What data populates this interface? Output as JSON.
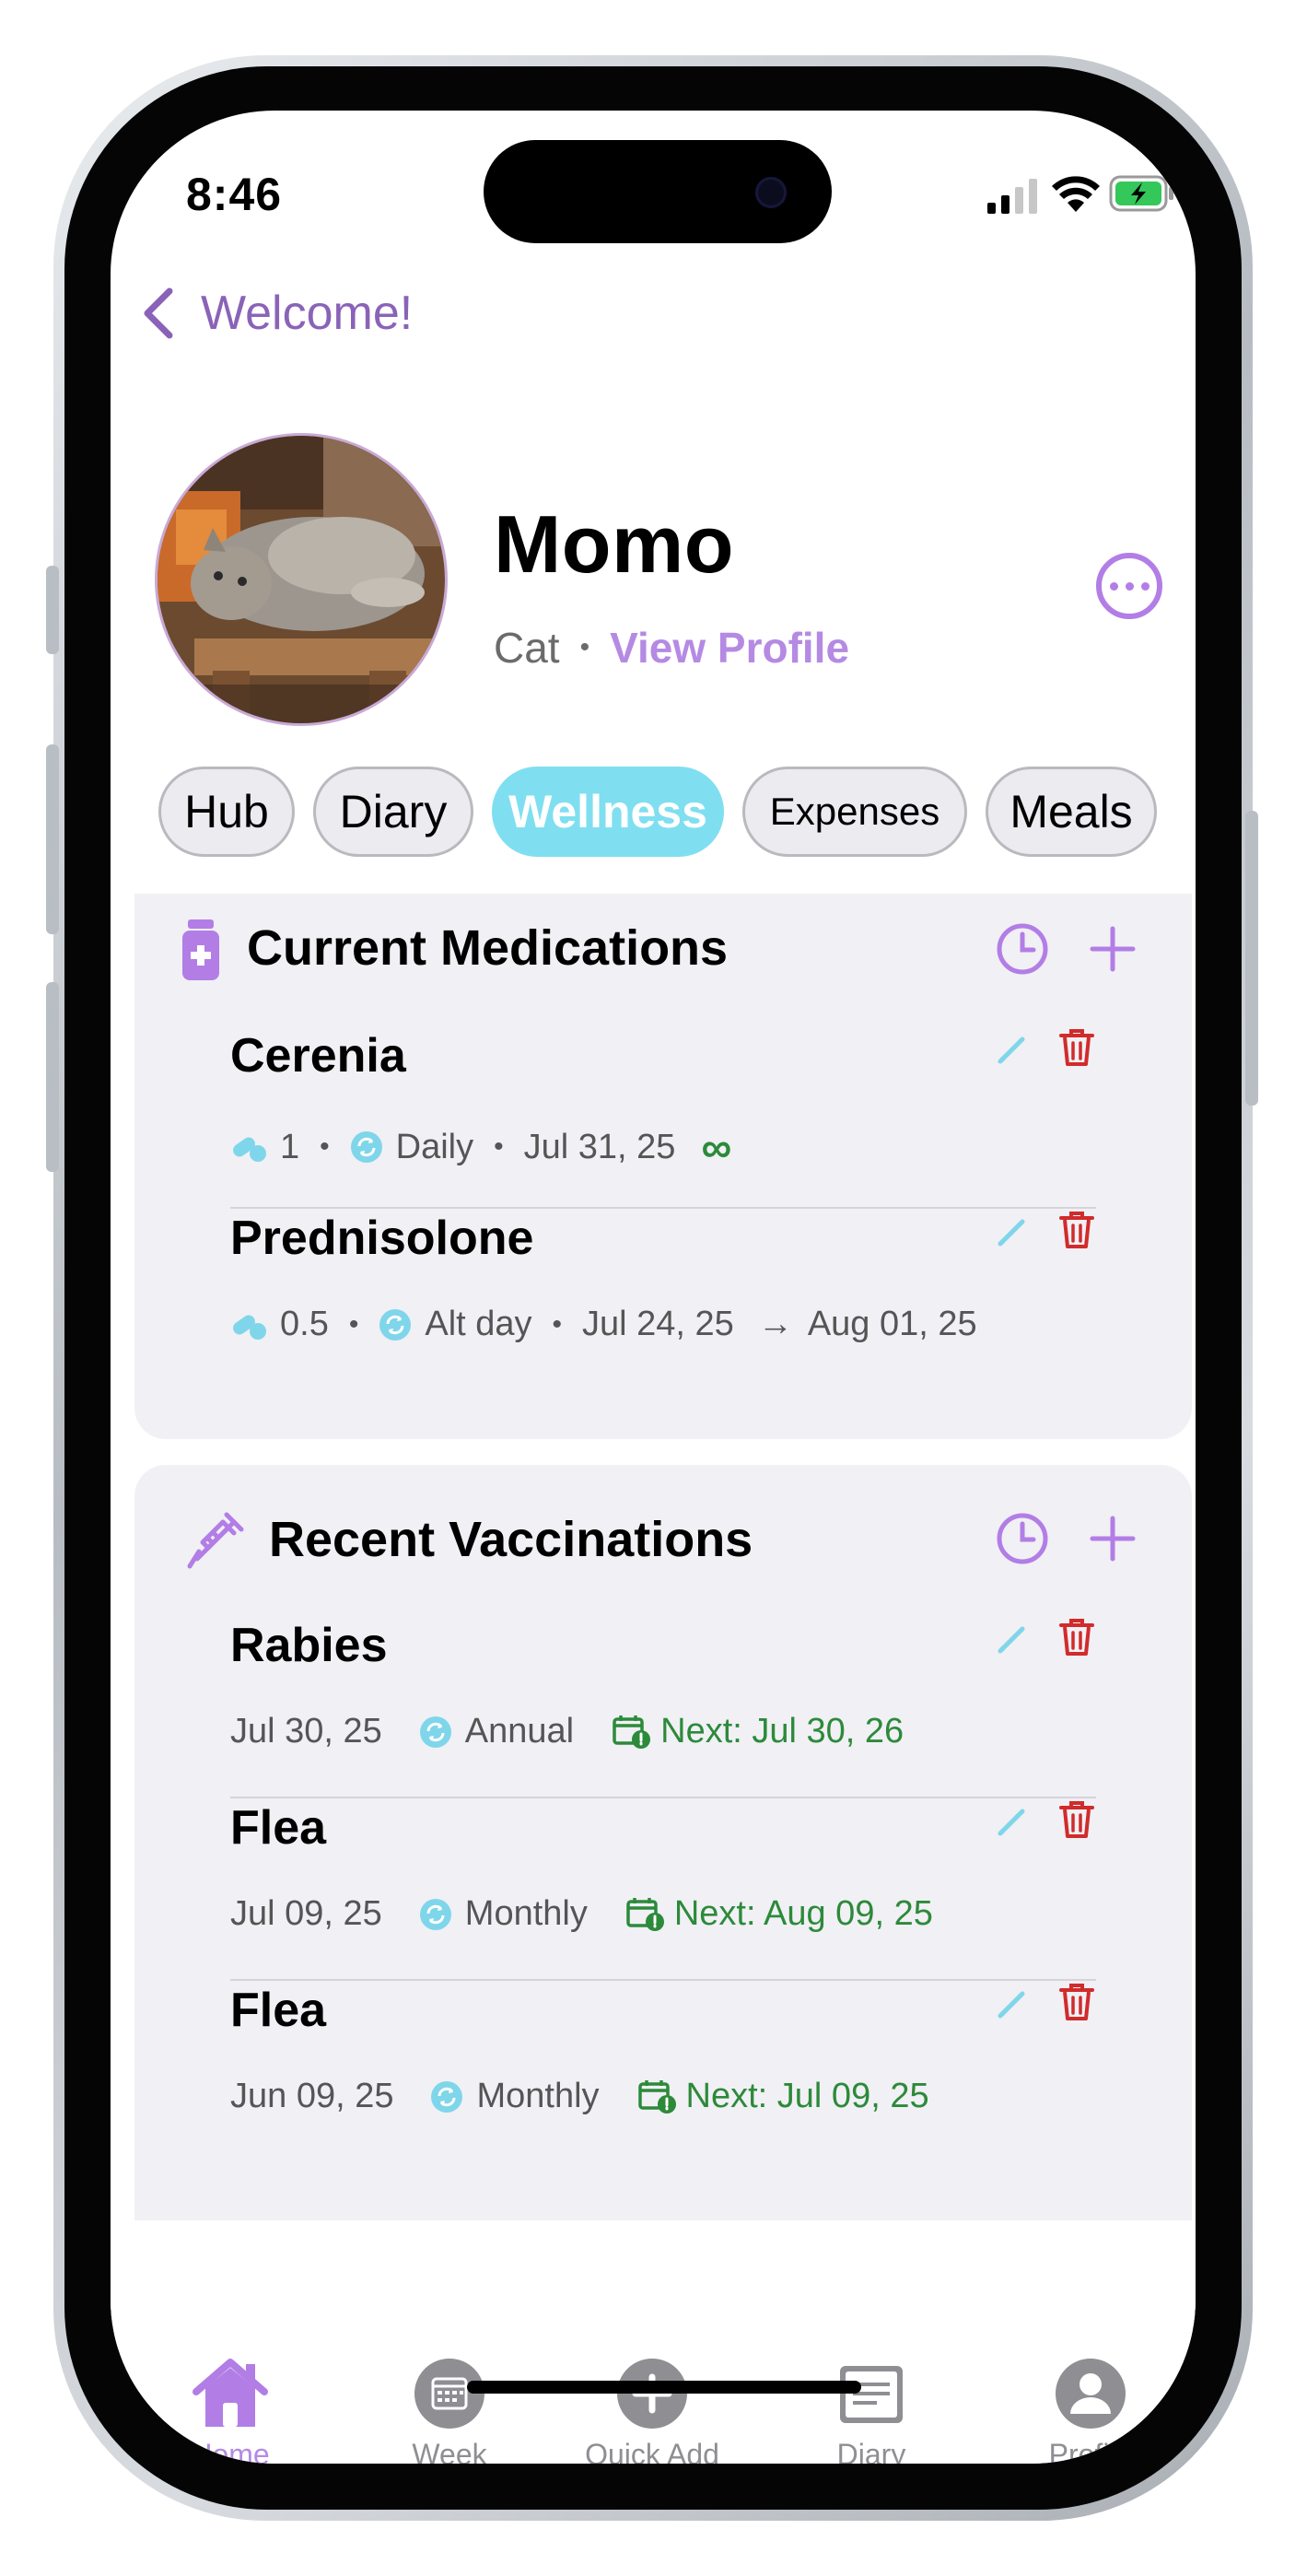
{
  "status": {
    "time": "8:46"
  },
  "nav": {
    "back_label": "Welcome!"
  },
  "pet": {
    "name": "Momo",
    "species": "Cat",
    "view_profile": "View Profile"
  },
  "tabs": [
    "Hub",
    "Diary",
    "Wellness",
    "Expenses",
    "Meals"
  ],
  "active_tab": "Wellness",
  "medications": {
    "title": "Current Medications",
    "items": [
      {
        "name": "Cerenia",
        "dose": "1",
        "frequency": "Daily",
        "start": "Jul 31, 25",
        "end": "∞"
      },
      {
        "name": "Prednisolone",
        "dose": "0.5",
        "frequency": "Alt day",
        "start": "Jul 24, 25",
        "arrow": "→",
        "end": "Aug 01, 25"
      }
    ]
  },
  "vaccinations": {
    "title": "Recent Vaccinations",
    "items": [
      {
        "name": "Rabies",
        "date": "Jul 30, 25",
        "frequency": "Annual",
        "next": "Next: Jul 30, 26"
      },
      {
        "name": "Flea",
        "date": "Jul 09, 25",
        "frequency": "Monthly",
        "next": "Next: Aug 09, 25"
      },
      {
        "name": "Flea",
        "date": "Jun 09, 25",
        "frequency": "Monthly",
        "next": "Next: Jul 09, 25"
      }
    ]
  },
  "tabbar": [
    {
      "label": "Home",
      "icon": "home-icon"
    },
    {
      "label": "Week",
      "icon": "calendar-icon"
    },
    {
      "label": "Quick Add",
      "icon": "plus-circle-icon"
    },
    {
      "label": "Diary",
      "icon": "document-icon"
    },
    {
      "label": "Profile",
      "icon": "person-icon"
    }
  ],
  "colors": {
    "accent_purple": "#b27ee6",
    "wellness_cyan": "#7fdff0",
    "delete_red": "#d12b2b",
    "next_green": "#2c8a3a",
    "card_bg": "#f1f0f5"
  }
}
